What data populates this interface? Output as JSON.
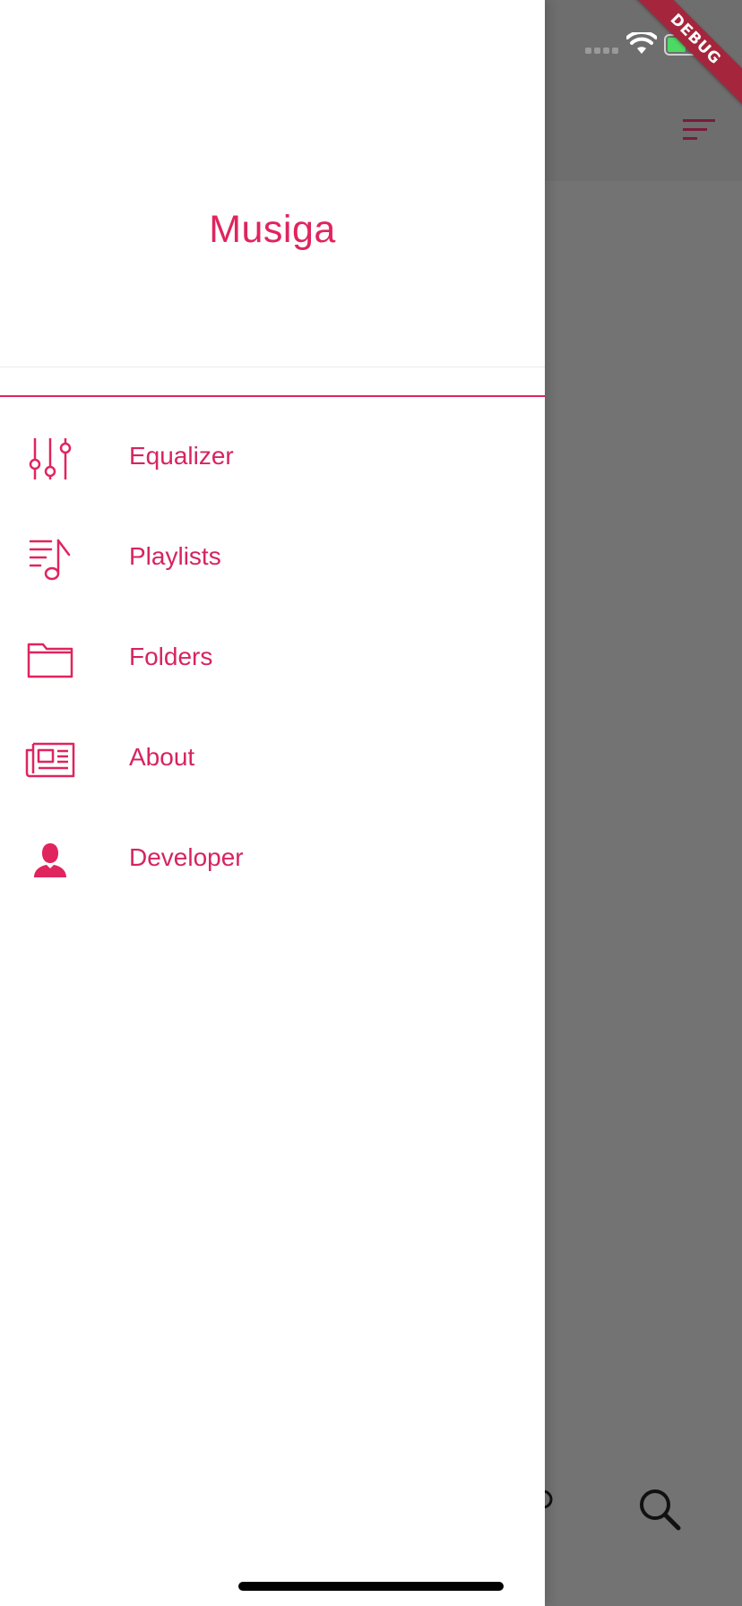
{
  "colors": {
    "accent": "#e0245e",
    "scrim": "#737373",
    "debug_banner": "#a5263c"
  },
  "drawer": {
    "title": "Musiga",
    "items": [
      {
        "label": "Equalizer",
        "icon": "equalizer-sliders-icon"
      },
      {
        "label": "Playlists",
        "icon": "playlist-music-icon"
      },
      {
        "label": "Folders",
        "icon": "folder-icon"
      },
      {
        "label": "About",
        "icon": "newspaper-icon"
      },
      {
        "label": "Developer",
        "icon": "person-icon"
      }
    ]
  },
  "debug_banner": {
    "label": "DEBUG"
  },
  "background": {
    "appbar_icon": "sort-icon",
    "bottom_icons": [
      "partial-icon",
      "search-icon"
    ]
  }
}
